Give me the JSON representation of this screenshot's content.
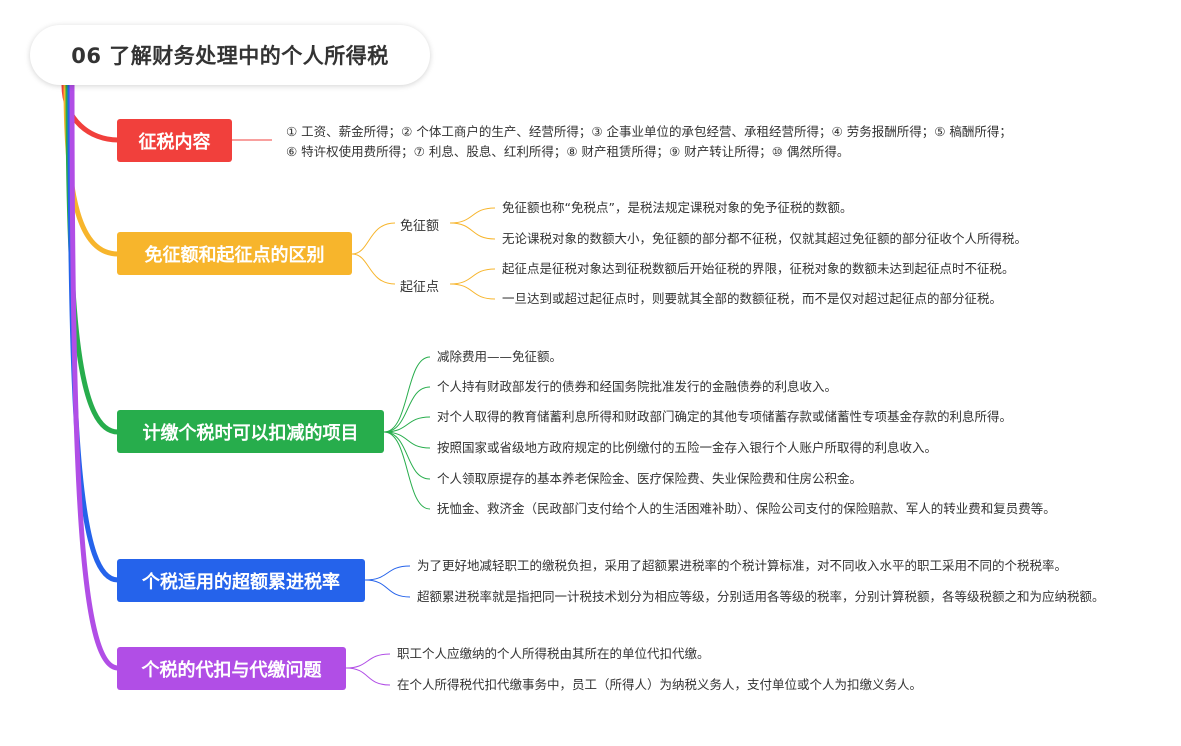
{
  "title": "06 了解财务处理中的个人所得税",
  "colors": {
    "red": "#f1403c",
    "yellow": "#f7b52c",
    "green": "#27ad4c",
    "blue": "#2563eb",
    "purple": "#b14ee6"
  },
  "branches": [
    {
      "label": "征税内容",
      "leaves": [
        "① 工资、薪金所得；② 个体工商户的生产、经营所得；③ 企事业单位的承包经营、承租经营所得；④ 劳务报酬所得；⑤ 稿酬所得；",
        "⑥ 特许权使用费所得；⑦ 利息、股息、红利所得；⑧ 财产租赁所得；⑨ 财产转让所得；⑩ 偶然所得。"
      ]
    },
    {
      "label": "免征额和起征点的区别",
      "subs": [
        {
          "label": "免征额",
          "leaves": [
            "免征额也称“免税点”，是税法规定课税对象的免予征税的数额。",
            "无论课税对象的数额大小，免征额的部分都不征税，仅就其超过免征额的部分征收个人所得税。"
          ]
        },
        {
          "label": "起征点",
          "leaves": [
            "起征点是征税对象达到征税数额后开始征税的界限，征税对象的数额未达到起征点时不征税。",
            "一旦达到或超过起征点时，则要就其全部的数额征税，而不是仅对超过起征点的部分征税。"
          ]
        }
      ]
    },
    {
      "label": "计缴个税时可以扣减的项目",
      "leaves": [
        "减除费用——免征额。",
        "个人持有财政部发行的债券和经国务院批准发行的金融债券的利息收入。",
        "对个人取得的教育储蓄利息所得和财政部门确定的其他专项储蓄存款或储蓄性专项基金存款的利息所得。",
        "按照国家或省级地方政府规定的比例缴付的五险一金存入银行个人账户所取得的利息收入。",
        "个人领取原提存的基本养老保险金、医疗保险费、失业保险费和住房公积金。",
        "抚恤金、救济金（民政部门支付给个人的生活困难补助）、保险公司支付的保险赔款、军人的转业费和复员费等。"
      ]
    },
    {
      "label": "个税适用的超额累进税率",
      "leaves": [
        "为了更好地减轻职工的缴税负担，采用了超额累进税率的个税计算标准，对不同收入水平的职工采用不同的个税税率。",
        "超额累进税率就是指把同一计税技术划分为相应等级，分别适用各等级的税率，分别计算税额，各等级税额之和为应纳税额。"
      ]
    },
    {
      "label": "个税的代扣与代缴问题",
      "leaves": [
        "职工个人应缴纳的个人所得税由其所在的单位代扣代缴。",
        "在个人所得税代扣代缴事务中，员工（所得人）为纳税义务人，支付单位或个人为扣缴义务人。"
      ]
    }
  ]
}
